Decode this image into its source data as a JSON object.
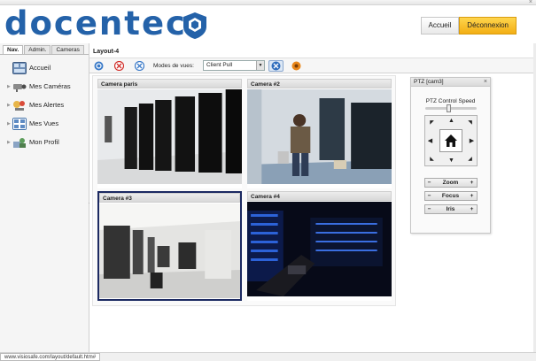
{
  "brand": {
    "logo_text": "docentec"
  },
  "header": {
    "home_label": "Accueil",
    "logout_label": "Déconnexion"
  },
  "sidebar": {
    "tabs": [
      "Nav.",
      "Admin.",
      "Cameras"
    ],
    "items": [
      {
        "label": "Accueil",
        "icon": "dashboard-icon"
      },
      {
        "label": "Mes Caméras",
        "icon": "camera-icon"
      },
      {
        "label": "Mes Alertes",
        "icon": "alert-icon"
      },
      {
        "label": "Mes Vues",
        "icon": "grid-view-icon"
      },
      {
        "label": "Mon Profil",
        "icon": "profile-icon"
      }
    ]
  },
  "layout": {
    "title": "Layout-4",
    "modes_label": "Modes de vues:",
    "mode_value": "Client Pull"
  },
  "cameras": [
    {
      "title": "Camera paris"
    },
    {
      "title": "Camera #2"
    },
    {
      "title": "Camera #3"
    },
    {
      "title": "Camera #4"
    }
  ],
  "ptz": {
    "title": "PTZ [cam3]",
    "close": "×",
    "speed_label": "PTZ Control Speed",
    "speed_level": 0.45,
    "zoom_label": "Zoom",
    "focus_label": "Focus",
    "iris_label": "Iris",
    "minus": "−",
    "plus": "+"
  },
  "status": {
    "url": "www.visiosafe.com/layout/default.htm#"
  },
  "colors": {
    "brand_blue": "#2462a9",
    "accent_orange": "#f3ae14",
    "selected_border": "#1c2a62"
  }
}
